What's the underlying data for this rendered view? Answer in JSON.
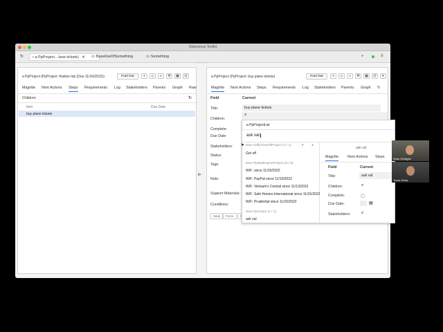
{
  "window": {
    "title": "Glamorous Toolkit",
    "tabs": [
      "a PpProject…lane tickets)",
      "BaselineOfSomething",
      "Something"
    ],
    "tab_close": "✕",
    "right_icons": [
      "search-icon",
      "status-dot-icon",
      "menu-icon"
    ]
  },
  "left_panel": {
    "title": "a PpProject (PpProject: finalize trip (Due 11/16/2022))",
    "fuel_out": "Fuel Out",
    "tabs": [
      "Magritte",
      "Next Actions",
      "Steps",
      "Requirements",
      "Log",
      "Stakeholders",
      "Parents",
      "Graph",
      "Raw"
    ],
    "active_tab": "Steps",
    "section": "Children",
    "columns": [
      "Item",
      "Due Date"
    ],
    "rows": [
      {
        "item": "buy plane tickets",
        "due": ""
      }
    ]
  },
  "right_panel": {
    "title": "a PpProject (PpProject: buy plane tickets)",
    "fuel_out": "Fuel Out",
    "tabs": [
      "Magritte",
      "Next Actions",
      "Steps",
      "Requirements",
      "Log",
      "Stakeholders",
      "Parents",
      "Graph"
    ],
    "active_tab": "Magritte",
    "columns": [
      "Field",
      "Current"
    ],
    "fields": [
      "Title:",
      "Children:",
      "Complete:",
      "Due Date:",
      "Stakeholders:",
      "Status:",
      "Tags:",
      "Note:",
      "Support Materials:",
      "Conditions:"
    ],
    "title_value": "buy plane tickets",
    "buttons": [
      "Save",
      "Force",
      "Ca"
    ]
  },
  "dropdown": {
    "header": "a PpProjectList",
    "input_value": "ask val",
    "groups": [
      {
        "title": "New SaflyTimeOfProject (1 / 1)",
        "items": [
          "Get off"
        ]
      },
      {
        "title": "New PpWaitingForProject (5 / 8)",
        "items": [
          "W/F: since 11/15/2022",
          "W/F: PayPal since 11/10/2022",
          "W/F: Vietnam's Central since 11/13/2022",
          "W/F: Safe Homes International since 11/15/2022",
          "W/F: Prudential since 11/15/2022"
        ]
      },
      {
        "title": "New PpAction (1 / 1)",
        "items": [
          "ask val"
        ]
      }
    ]
  },
  "preview": {
    "title": "ask val",
    "tabs": [
      "Magritte",
      "Next Actions",
      "Steps"
    ],
    "active_tab": "Magritte",
    "columns": [
      "Field",
      "Current"
    ],
    "fields": [
      "Title:",
      "Children:",
      "Complete:",
      "Due Date:",
      "Stakeholders:"
    ],
    "title_value": "ask val"
  },
  "participants": [
    {
      "name": "Sean DeNigris"
    },
    {
      "name": "Tudor Girba"
    }
  ],
  "colors": {
    "accent": "#2a6ed6",
    "selected_row": "#dce8f7"
  }
}
